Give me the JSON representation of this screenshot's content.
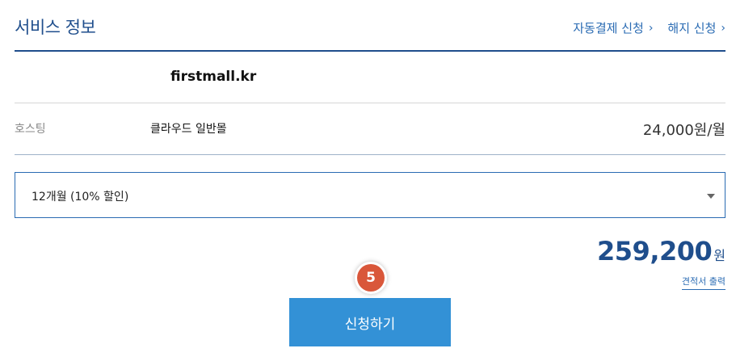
{
  "header": {
    "title": "서비스 정보",
    "links": [
      {
        "label": "자동결제 신청",
        "icon": "chevron-right-icon"
      },
      {
        "label": "해지 신청",
        "icon": "chevron-right-icon"
      }
    ]
  },
  "domain": "firstmall.kr",
  "hosting": {
    "label": "호스팅",
    "plan": "클라우드 일반몰",
    "price": "24,000원/월"
  },
  "period_select": {
    "selected": "12개월 (10% 할인)"
  },
  "total": {
    "amount": "259,200",
    "unit": "원"
  },
  "quote_link": "견적서 출력",
  "step_badge": "5",
  "apply_button": "신청하기",
  "colors": {
    "primary": "#1f4e8c",
    "link": "#2a6bb3",
    "button": "#3391d6",
    "badge": "#d9573a"
  }
}
